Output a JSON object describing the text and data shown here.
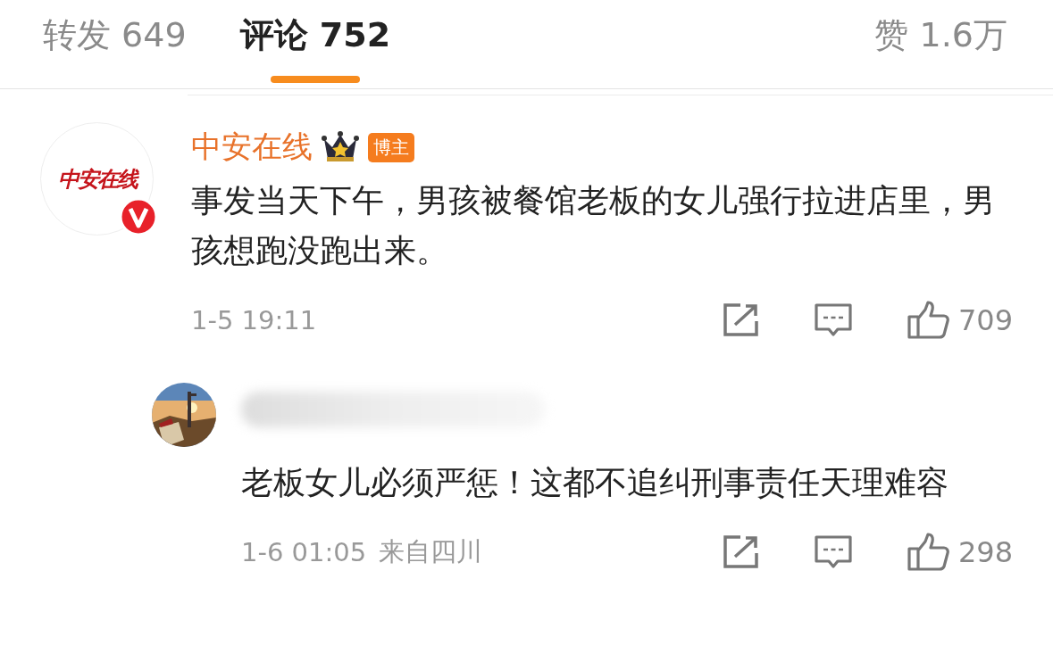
{
  "tabs": [
    {
      "label": "转发 649",
      "selected": false
    },
    {
      "label": "评论 752",
      "selected": true
    },
    {
      "label": "赞 1.6万",
      "selected": false
    }
  ],
  "comment": {
    "avatar_logo": "中安在线",
    "verified": true,
    "name": "中安在线",
    "badge": "博主",
    "text": "事发当天下午，男孩被餐馆老板的女儿强行拉进店里，男孩想跑没跑出来。",
    "time": "1-5 19:11",
    "likes": "709",
    "reply": {
      "text": "老板女儿必须严惩！这都不追纠刑事责任天理难容",
      "time": "1-6 01:05",
      "location": "来自四川",
      "likes": "298"
    }
  }
}
